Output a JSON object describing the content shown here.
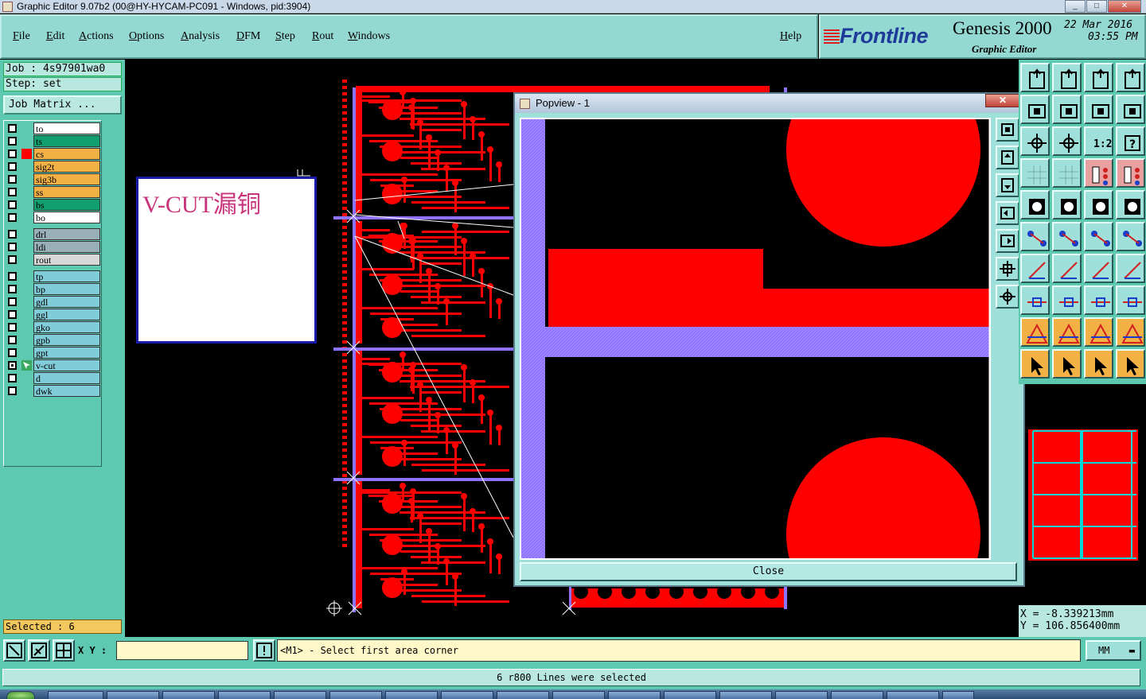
{
  "window": {
    "title": "Graphic Editor 9.07b2 (00@HY-HYCAM-PC091 - Windows, pid:3904)",
    "minimize_icon": "minimize-icon",
    "maximize_icon": "maximize-icon",
    "close_icon": "close-icon"
  },
  "menu": {
    "items": [
      "File",
      "Edit",
      "Actions",
      "Options",
      "Analysis",
      "DFM",
      "Step",
      "Rout",
      "Windows"
    ],
    "help": "Help"
  },
  "brand": {
    "logo": "Frontline",
    "product": "Genesis 2000",
    "subtitle": "Graphic Editor",
    "date": "22 Mar 2016",
    "time": "03:55 PM"
  },
  "job": {
    "job_label": "Job : 4s97901wa0",
    "step_label": "Step: set",
    "job_matrix": "Job Matrix ..."
  },
  "layers": [
    {
      "name": "to",
      "color": "#ffffff",
      "checked": false,
      "mark": ""
    },
    {
      "name": "ts",
      "color": "#10a070",
      "checked": false,
      "mark": ""
    },
    {
      "name": "cs",
      "color": "#f3b145",
      "checked": false,
      "mark": "red"
    },
    {
      "name": "sig2t",
      "color": "#f3b145",
      "checked": false,
      "mark": ""
    },
    {
      "name": "sig3b",
      "color": "#f3b145",
      "checked": false,
      "mark": ""
    },
    {
      "name": "ss",
      "color": "#f3b145",
      "checked": false,
      "mark": ""
    },
    {
      "name": "bs",
      "color": "#10a070",
      "checked": false,
      "mark": ""
    },
    {
      "name": "bo",
      "color": "#ffffff",
      "checked": false,
      "mark": ""
    },
    {
      "name": "drl",
      "color": "#9ab0b8",
      "checked": false,
      "mark": ""
    },
    {
      "name": "ldi",
      "color": "#9ab0b8",
      "checked": false,
      "mark": ""
    },
    {
      "name": "rout",
      "color": "#d8d8d8",
      "checked": false,
      "mark": ""
    },
    {
      "name": "tp",
      "color": "#80ccd8",
      "checked": false,
      "mark": ""
    },
    {
      "name": "bp",
      "color": "#80ccd8",
      "checked": false,
      "mark": ""
    },
    {
      "name": "gdl",
      "color": "#80ccd8",
      "checked": false,
      "mark": ""
    },
    {
      "name": "ggl",
      "color": "#80ccd8",
      "checked": false,
      "mark": ""
    },
    {
      "name": "gko",
      "color": "#80ccd8",
      "checked": false,
      "mark": ""
    },
    {
      "name": "gpb",
      "color": "#80ccd8",
      "checked": false,
      "mark": ""
    },
    {
      "name": "gpt",
      "color": "#80ccd8",
      "checked": false,
      "mark": ""
    },
    {
      "name": "v-cut",
      "color": "#80ccd8",
      "checked": true,
      "mark": "edit"
    },
    {
      "name": "d",
      "color": "#80ccd8",
      "checked": false,
      "mark": ""
    },
    {
      "name": "dwk",
      "color": "#80ccd8",
      "checked": false,
      "mark": ""
    }
  ],
  "selected": "Selected : 6",
  "note": {
    "text": "V-CUT漏铜"
  },
  "popview": {
    "title": "Popview - 1",
    "close": "Close"
  },
  "coords": {
    "x": "X  =  -8.339213mm",
    "y": "Y  =  106.856400mm"
  },
  "command": {
    "xy_label": "X Y :",
    "xy_value": "",
    "prompt": "<M1> - Select first area corner",
    "units": "MM"
  },
  "status": "6 r800 Lines were selected",
  "colors": {
    "panel": "#5ec9b1",
    "menu": "#94d8d2",
    "copper": "#ff0000",
    "vcut": "#8f72ff",
    "highlight": "#f3b145"
  }
}
